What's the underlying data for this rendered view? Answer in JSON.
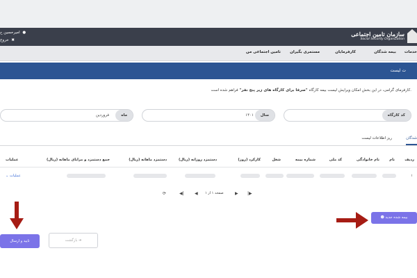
{
  "header": {
    "logo_fa": "سازمان تامین اجتماعی",
    "logo_en": "Social Security Organization",
    "user_name": "امیرحسین ح",
    "logout_label": "خروج"
  },
  "nav": {
    "items": [
      "بیمه شدگان",
      "کارفرمایان",
      "مستمری بگیران",
      "تامین اجتماعی من"
    ],
    "cut_item": "خدمات"
  },
  "page": {
    "title": "ت لیست"
  },
  "notice": {
    "prefix": "کارفرمای گرامی، در این بخش امکان ویرایش لیست بیمه کارگاه",
    "bold": "\"صرفا برای کارگاه های زیر پنج نفر\"",
    "suffix": "فراهم شده است."
  },
  "form": {
    "workshop_code_label": "کد کارگاه",
    "workshop_code_value": "",
    "year_label": "سال",
    "year_value": "۱۴۰۱",
    "month_label": "ماه",
    "month_value": "فروردین"
  },
  "tabs": {
    "insured": "شدگان",
    "list_details": "ریز اطلاعات لیست"
  },
  "table": {
    "headers": {
      "row": "ردیف",
      "name": "نام",
      "family": "نام خانوادگی",
      "national_code": "کد ملی",
      "insurance_no": "شماره بیمه",
      "job": "شغل",
      "work_days": "کارکرد (روز)",
      "daily_wage": "دستمزد روزانه (ریال)",
      "monthly_wage": "دستمزد ماهانه (ریال)",
      "total_wage": "جمع دستمزد و مزایای ماهانه (ریال)",
      "operations": "عملیات"
    },
    "rows": [
      {
        "row": "۱",
        "operations": "عملیات"
      }
    ]
  },
  "pager": {
    "text": "صفحه ۱ از ۱"
  },
  "buttons": {
    "new_insured": "بیمه شده جدید",
    "confirm_send": "تایید و ارسال",
    "back": "بازگشت"
  },
  "colors": {
    "header_bg": "#3a3f4b",
    "title_bar": "#2c5593",
    "accent_button": "#7b73e8",
    "annotation_arrow": "#a61c14"
  }
}
